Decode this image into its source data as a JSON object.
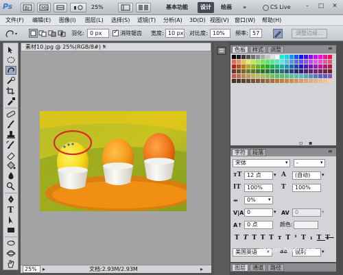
{
  "app": {
    "logo": "Ps"
  },
  "topbar": {
    "zoom": "25%",
    "workspaces": [
      "基本功能",
      "设计",
      "绘画"
    ],
    "more": "»",
    "cs_live": "CS Live",
    "win_min": "–",
    "win_max": "□",
    "win_close": "✕"
  },
  "menus": [
    "文件(F)",
    "编辑(E)",
    "图像(I)",
    "图层(L)",
    "选择(S)",
    "滤镜(T)",
    "分析(A)",
    "3D(D)",
    "视图(V)",
    "窗口(W)",
    "帮助(H)"
  ],
  "options": {
    "feather_label": "羽化:",
    "feather_value": "0 px",
    "antialias_label": "消除锯齿",
    "antialias_checked": true,
    "width_label": "宽度:",
    "width_value": "10 px",
    "contrast_label": "对比度:",
    "contrast_value": "10%",
    "frequency_label": "频率:",
    "frequency_value": "57",
    "refine_edge": "调整边缘..."
  },
  "document": {
    "tab_title": "素材10.jpg @ 25%(RGB/8#) *",
    "zoom": "25%",
    "doc_info": "文档:2.93M/2.93M"
  },
  "swatches": {
    "tabs": [
      "色板",
      "样式",
      "调整"
    ],
    "active_tab": 0
  },
  "character": {
    "tabs": [
      "字符",
      "段落"
    ],
    "active_tab": 0,
    "font_family": "宋体",
    "font_style": "-",
    "font_size": "12 点",
    "leading": "(自动)",
    "vertical_scale": "100%",
    "horizontal_scale": "100%",
    "tracking_pct": "0%",
    "kerning": "0",
    "tracking": "0",
    "baseline_shift": "0 点",
    "color_label": "颜色:",
    "language": "美国英语",
    "antialias": "锐利"
  },
  "layers": {
    "tabs": [
      "图层",
      "通道",
      "路径"
    ]
  },
  "watermark": "jingyan.baidu.com"
}
